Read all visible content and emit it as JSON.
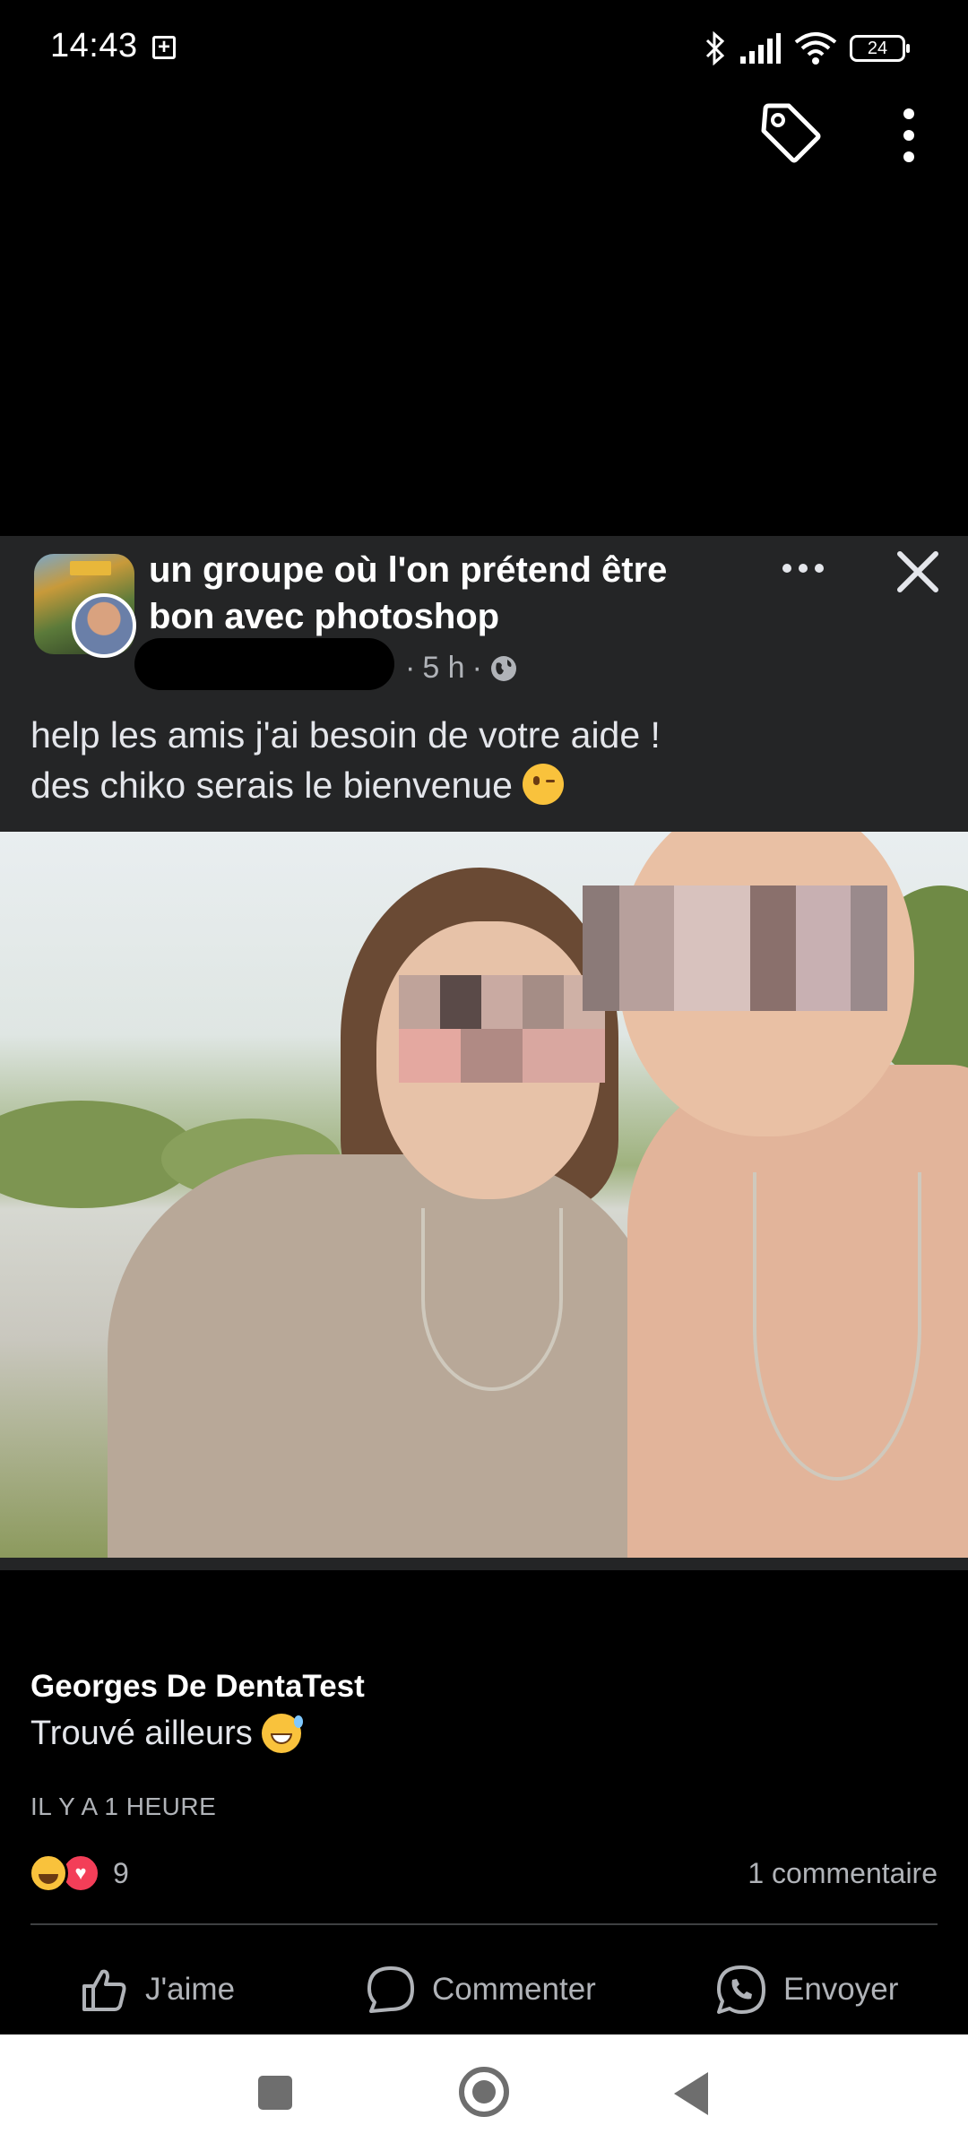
{
  "status_bar": {
    "time": "14:43",
    "battery": "24"
  },
  "post": {
    "group_name": "un groupe où l'on prétend être bon avec photoshop",
    "age": "5 h",
    "separator": "·",
    "text_lines": [
      "help les amis j'ai besoin de votre aide !",
      "des chiko serais le bienvenue"
    ],
    "icons": {
      "tag": "tag-icon",
      "more": "more-vertical-icon",
      "options": "more-horizontal-icon",
      "close": "close-icon",
      "privacy": "globe-icon"
    }
  },
  "comment": {
    "author": "Georges De DentaTest",
    "text": "Trouvé ailleurs",
    "time_ago": "IL Y A 1 HEURE"
  },
  "reactions": {
    "count": "9",
    "comments_label": "1 commentaire",
    "types": [
      "haha",
      "love"
    ]
  },
  "actions": {
    "like_label": "J'aime",
    "comment_label": "Commenter",
    "send_label": "Envoyer"
  },
  "colors": {
    "background": "#000000",
    "card": "#242526",
    "secondary_text": "#b0b3b8",
    "love": "#f33e58",
    "haha": "#f9c23c"
  }
}
